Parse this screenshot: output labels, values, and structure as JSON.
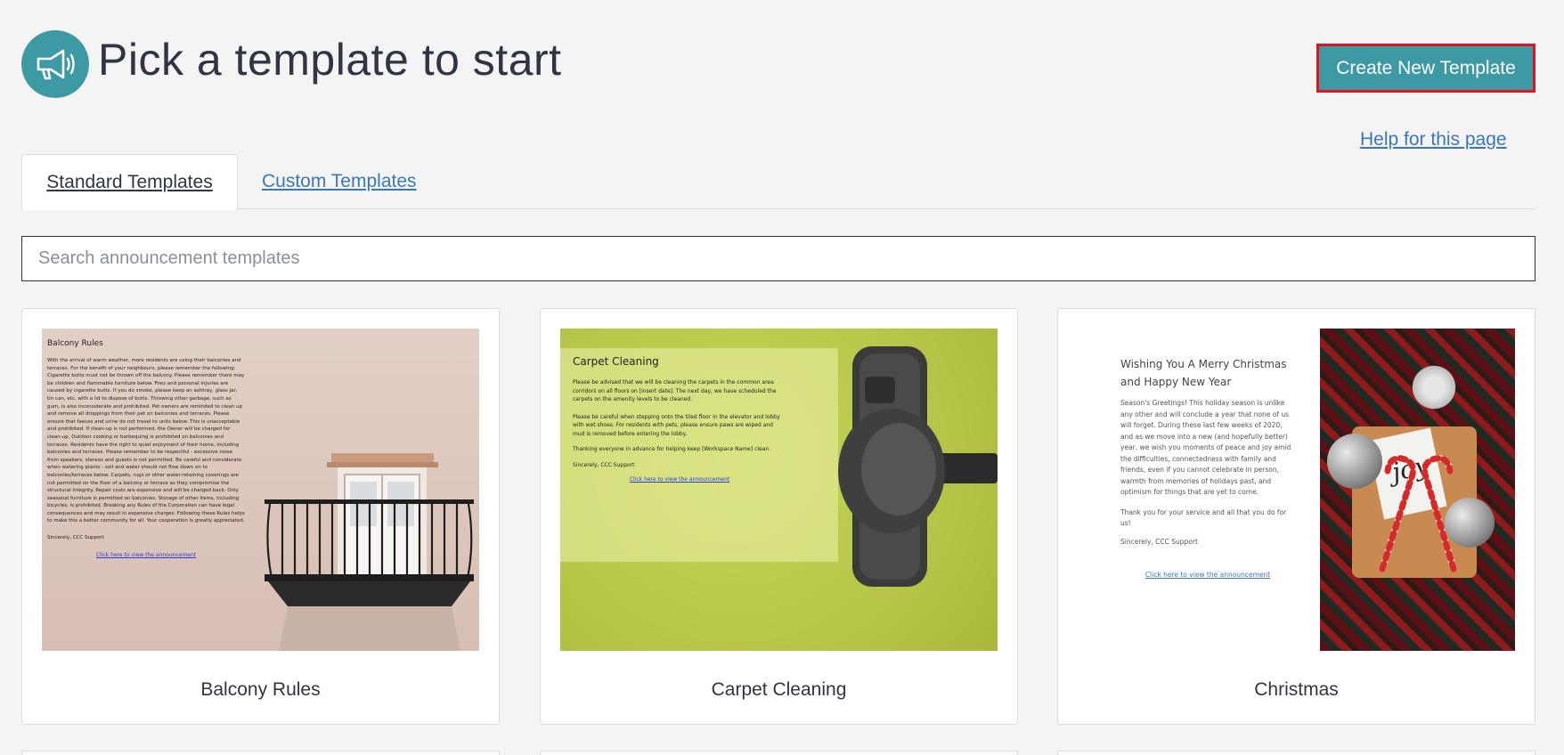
{
  "header": {
    "icon": "megaphone-icon",
    "title": "Pick a template to start",
    "create_button_label": "Create New Template",
    "help_link": "Help for this page"
  },
  "tabs": [
    {
      "label": "Standard Templates",
      "active": true
    },
    {
      "label": "Custom Templates",
      "active": false
    }
  ],
  "search": {
    "placeholder": "Search announcement templates",
    "value": ""
  },
  "templates": [
    {
      "title": "Balcony Rules",
      "preview": {
        "heading": "Balcony Rules",
        "body": "With the arrival of warm weather, more residents are using their balconies and terraces. For the benefit of your neighbours, please remember the following: Cigarette butts must not be thrown off the balcony. Please remember there may be children and flammable furniture below. Fires and personal injuries are caused by cigarette butts. If you do smoke, please keep an ashtray, glass jar, tin can, etc. with a lid to dispose of butts. Throwing other garbage, such as gum, is also inconsiderate and prohibited. Pet owners are reminded to clean up and remove all droppings from their pet on balconies and terraces. Please ensure that faeces and urine do not travel to units below. This is unacceptable and prohibited. If clean-up is not performed, the Owner will be charged for clean-up. Outdoor cooking or barbequing is prohibited on balconies and terraces. Residents have the right to quiet enjoyment of their home, including balconies and terraces. Please remember to be respectful - excessive noise from speakers, stereos and guests is not permitted. Be careful and considerate when watering plants - soil and water should not flow down on to balconies/terraces below. Carpets, rugs or other water-retaining coverings are not permitted on the floor of a balcony or terrace as they compromise the structural integrity. Repair costs are expensive and will be charged back. Only seasonal furniture is permitted on balconies. Storage of other items, including bicycles, is prohibited. Breaking any Rules of the Corporation can have legal consequences and may result in expensive charges. Following these Rules helps to make this a better community for all. Your cooperation is greatly appreciated.",
        "signoff": "Sincerely, CCC Support",
        "link": "Click here to view the announcement"
      }
    },
    {
      "title": "Carpet Cleaning",
      "preview": {
        "heading": "Carpet Cleaning",
        "body": "Please be advised that we will be cleaning the carpets in the common area corridors on all floors on [insert date]. The next day, we have scheduled the carpets on the amenity levels to be cleaned.",
        "body2": "Please be careful when stepping onto the tiled floor in the elevator and lobby with wet shoes. For residents with pets, please ensure paws are wiped and mud is removed before entering the lobby.",
        "body3": "Thanking everyone in advance for helping keep [Workspace Name] clean.",
        "signoff": "Sincerely, CCC Support",
        "link": "Click here to view the announcement"
      }
    },
    {
      "title": "Christmas",
      "preview": {
        "heading": "Wishing You A Merry Christmas and Happy New Year",
        "body": "Season's Greetings! This holiday season is unlike any other and will conclude a year that none of us will forget. During these last few weeks of 2020, and as we move into a new (and hopefully better) year, we wish you moments of peace and joy amid the difficulties, connectedness with family and friends, even if you cannot celebrate in person, warmth from memories of holidays past, and optimism for things that are yet to come.",
        "body2": "Thank you for your service and all that you do for us!",
        "signoff": "Sincerely, CCC Support",
        "link": "Click here to view the announcement",
        "image_text": "joy"
      }
    }
  ],
  "colors": {
    "accent": "#3d9aa4",
    "link": "#3a78b5",
    "highlight_border": "#e0141e"
  }
}
